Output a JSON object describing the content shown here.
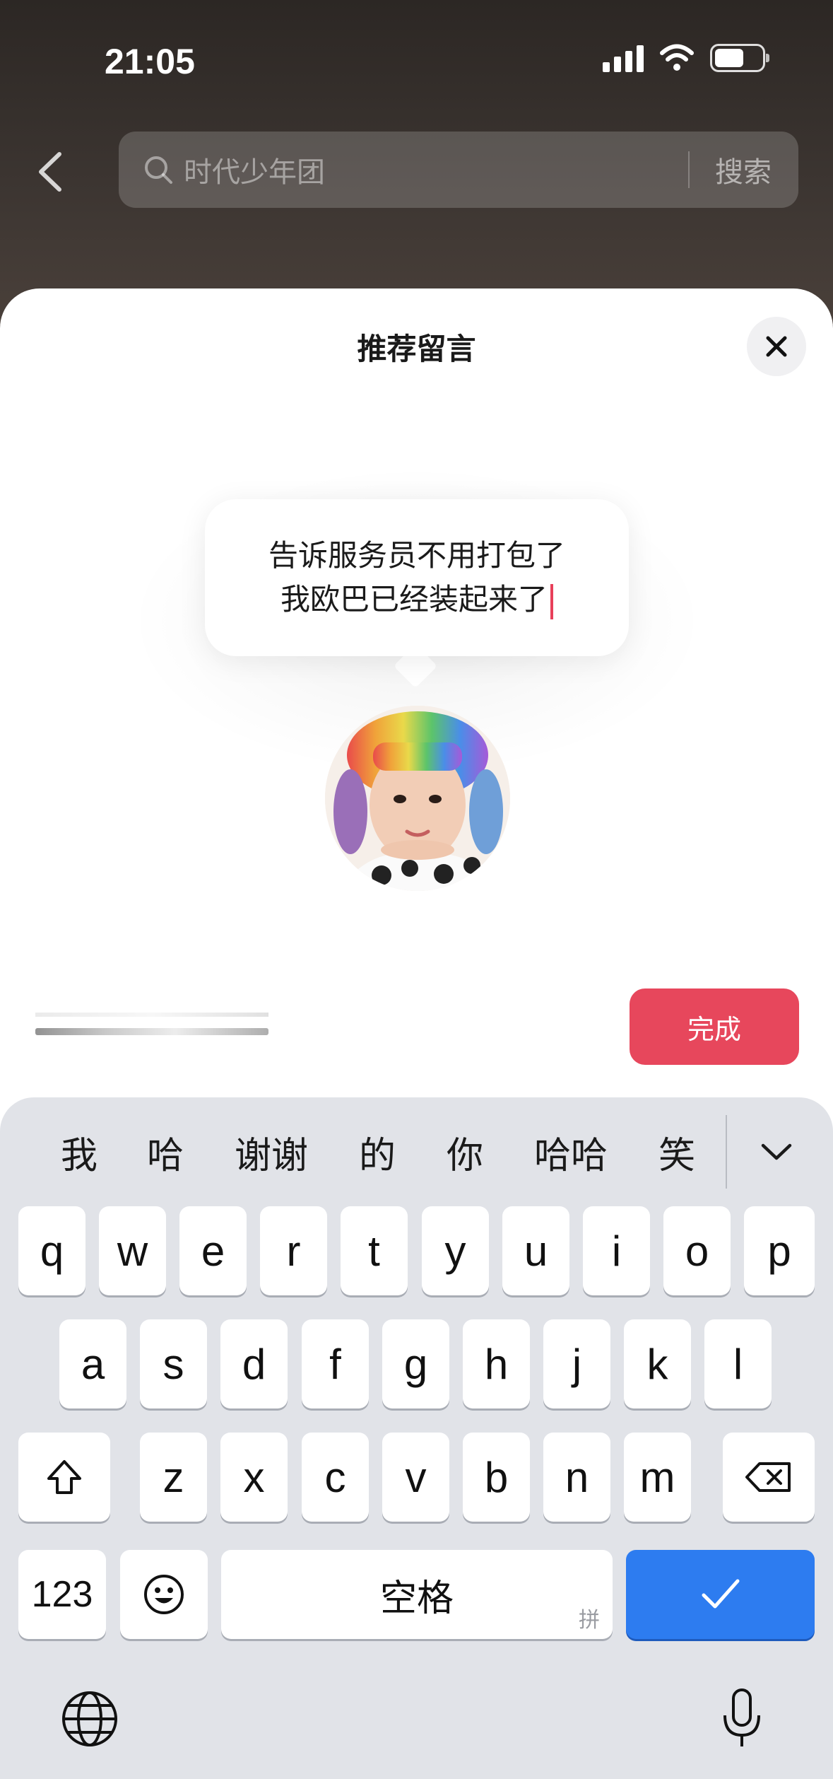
{
  "status_bar": {
    "time": "21:05"
  },
  "search": {
    "placeholder": "时代少年团",
    "button": "搜索"
  },
  "sheet": {
    "title": "推荐留言"
  },
  "message": {
    "line1": "告诉服务员不用打包了",
    "line2": "我欧巴已经装起来了"
  },
  "done_button": "完成",
  "keyboard": {
    "candidates": [
      "我",
      "哈",
      "谢谢",
      "的",
      "你",
      "哈哈",
      "笑"
    ],
    "row1": [
      "q",
      "w",
      "e",
      "r",
      "t",
      "y",
      "u",
      "i",
      "o",
      "p"
    ],
    "row2": [
      "a",
      "s",
      "d",
      "f",
      "g",
      "h",
      "j",
      "k",
      "l"
    ],
    "row3": [
      "z",
      "x",
      "c",
      "v",
      "b",
      "n",
      "m"
    ],
    "numbers_key": "123",
    "space_label": "空格",
    "space_sublabel": "拼"
  },
  "colors": {
    "accent": "#e7475c",
    "confirm": "#2d7cf0",
    "keyboard_bg": "#e1e3e8"
  }
}
